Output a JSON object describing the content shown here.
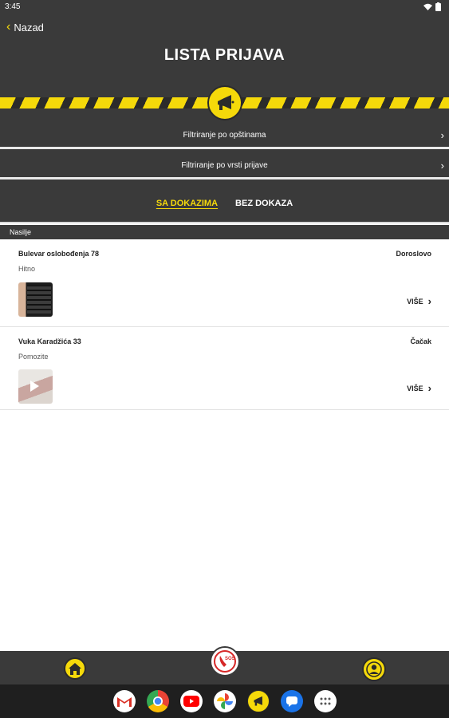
{
  "status_bar": {
    "time": "3:45"
  },
  "header": {
    "back_label": "Nazad",
    "title": "LISTA PRIJAVA"
  },
  "filters": [
    {
      "label": "Filtriranje po opštinama"
    },
    {
      "label": "Filtriranje po vrsti prijave"
    }
  ],
  "tabs": [
    {
      "label": "SA DOKAZIMA",
      "active": true
    },
    {
      "label": "BEZ DOKAZA",
      "active": false
    }
  ],
  "section": {
    "label": "Nasilje"
  },
  "reports": [
    {
      "street": "Bulevar oslobođenja 78",
      "city": "Doroslovo",
      "description": "Hitno",
      "more_label": "VIŠE",
      "thumbnail": "keyboard-photo"
    },
    {
      "street": "Vuka Karadžića 33",
      "city": "Čačak",
      "description": "Pomozite",
      "more_label": "VIŠE",
      "thumbnail": "video-thumbnail"
    }
  ],
  "colors": {
    "accent": "#f5d90a",
    "dark": "#3a3a3a"
  },
  "dock_apps": [
    "gmail-icon",
    "chrome-icon",
    "youtube-icon",
    "photos-icon",
    "app-megaphone-icon",
    "messages-icon",
    "app-drawer-icon"
  ]
}
